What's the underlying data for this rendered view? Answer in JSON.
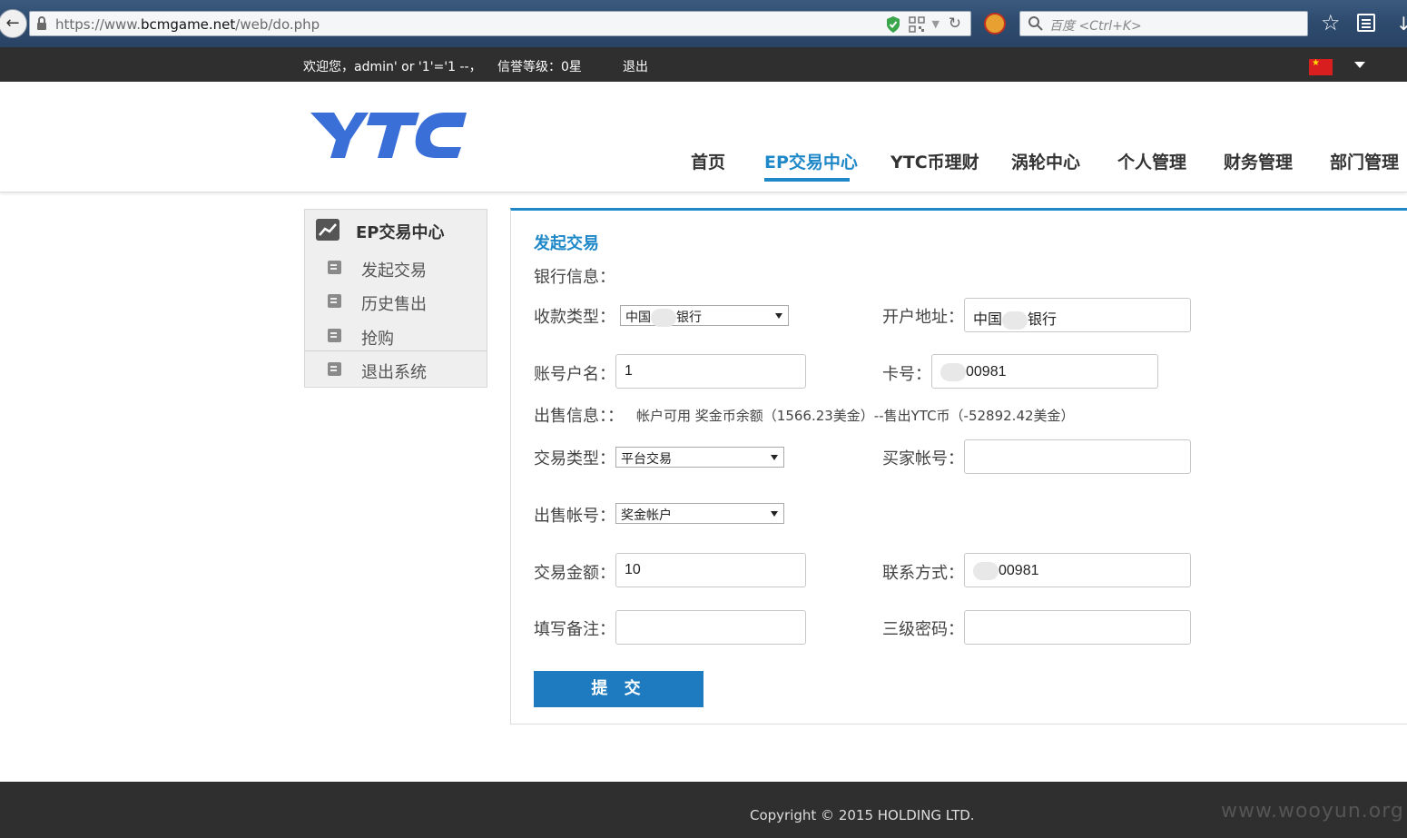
{
  "browser": {
    "url_prefix": "https://www.",
    "url_domain": "bcmgame.net",
    "url_path": "/web/do.php",
    "search_placeholder": "百度 <Ctrl+K>"
  },
  "topbar": {
    "welcome": "欢迎您，admin' or '1'='1 --，",
    "credit": "信誉等级：0星",
    "logout": "退出"
  },
  "header": {
    "logo": "YTC",
    "nav": [
      {
        "label": "首页"
      },
      {
        "label": "EP交易中心",
        "active": true
      },
      {
        "label": "YTC币理财"
      },
      {
        "label": "涡轮中心"
      },
      {
        "label": "个人管理"
      },
      {
        "label": "财务管理"
      },
      {
        "label": "部门管理"
      }
    ]
  },
  "sidebar": {
    "title": "EP交易中心",
    "items": [
      {
        "label": "发起交易"
      },
      {
        "label": "历史售出"
      },
      {
        "label": "抢购"
      },
      {
        "label": "退出系统"
      }
    ]
  },
  "form": {
    "title": "发起交易",
    "bank_info_label": "银行信息：",
    "payee_type_label": "收款类型：",
    "payee_type_value_a": "中国",
    "payee_type_value_b": "银行",
    "bank_addr_label": "开户地址：",
    "bank_addr_value_a": "中国",
    "bank_addr_value_b": "银行",
    "account_name_label": "账号户名：",
    "account_name_value": "1",
    "card_no_label": "卡号：",
    "card_no_value": "00981",
    "sale_info_label": "出售信息：：",
    "sale_info_text": "帐户可用 奖金币余额（1566.23美金）--售出YTC币（-52892.42美金）",
    "trade_type_label": "交易类型：",
    "trade_type_value": "平台交易",
    "buyer_account_label": "买家帐号：",
    "buyer_account_value": "",
    "sell_account_label": "出售帐号：",
    "sell_account_value": "奖金帐户",
    "amount_label": "交易金额：",
    "amount_value": "10",
    "contact_label": "联系方式：",
    "contact_value": "00981",
    "note_label": "填写备注：",
    "note_value": "",
    "pwd_label": "三级密码：",
    "pwd_value": "",
    "submit": "提 交"
  },
  "footer": {
    "copyright": "Copyright © 2015 HOLDING LTD.",
    "watermark": "www.wooyun.org"
  },
  "colors": {
    "accent": "#1e88c8",
    "topbar": "#2f2f2f",
    "submit": "#1e7bbf",
    "logo": "#3a6fd8"
  }
}
